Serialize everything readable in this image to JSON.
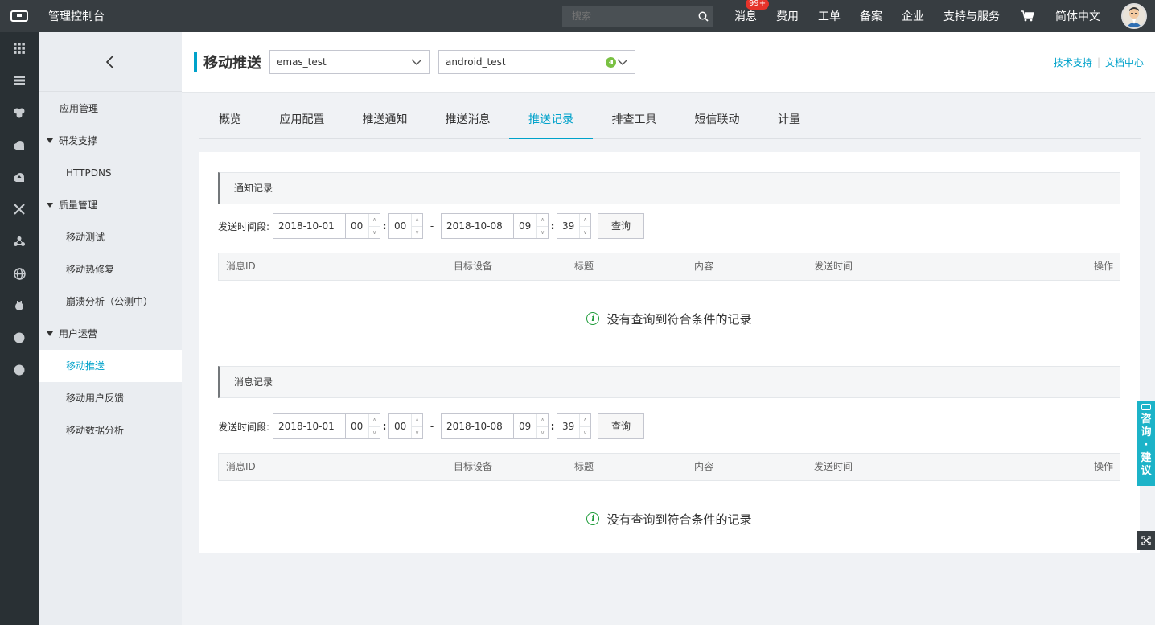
{
  "topbar": {
    "console_title": "管理控制台",
    "search_placeholder": "搜索",
    "nav": {
      "messages": "消息",
      "messages_badge": "99+",
      "billing": "费用",
      "tickets": "工单",
      "icp": "备案",
      "enterprise": "企业",
      "support": "支持与服务",
      "language": "简体中文"
    }
  },
  "rail": {
    "icons": [
      "grid-icon",
      "server-icon",
      "shield-icon",
      "cloud-icon",
      "cloud-upload-icon",
      "network-icon",
      "nodes-icon",
      "globe-icon",
      "bug-icon",
      "dot-icon",
      "dot-icon"
    ]
  },
  "sidebar": {
    "items": [
      {
        "label": "应用管理",
        "kind": "top"
      },
      {
        "label": "研发支撑",
        "kind": "group"
      },
      {
        "label": "HTTPDNS",
        "kind": "sub"
      },
      {
        "label": "质量管理",
        "kind": "group"
      },
      {
        "label": "移动测试",
        "kind": "sub"
      },
      {
        "label": "移动热修复",
        "kind": "sub"
      },
      {
        "label": "崩溃分析（公测中）",
        "kind": "sub"
      },
      {
        "label": "用户运营",
        "kind": "group"
      },
      {
        "label": "移动推送",
        "kind": "sub",
        "active": true
      },
      {
        "label": "移动用户反馈",
        "kind": "sub"
      },
      {
        "label": "移动数据分析",
        "kind": "sub"
      }
    ]
  },
  "header": {
    "title": "移动推送",
    "app_select": "emas_test",
    "platform_select": "android_test",
    "links": {
      "tech_support": "技术支持",
      "docs": "文档中心"
    }
  },
  "tabs": [
    "概览",
    "应用配置",
    "推送通知",
    "推送消息",
    "推送记录",
    "排查工具",
    "短信联动",
    "计量"
  ],
  "active_tab": "推送记录",
  "columns": [
    "消息ID",
    "目标设备",
    "标题",
    "内容",
    "发送时间",
    "操作"
  ],
  "sections": {
    "notify": {
      "title": "通知记录",
      "label": "发送时间段:",
      "start_date": "2018-10-01",
      "start_hour": "00",
      "start_min": "00",
      "end_date": "2018-10-08",
      "end_hour": "09",
      "end_min": "39",
      "query": "查询",
      "empty": "没有查询到符合条件的记录"
    },
    "message": {
      "title": "消息记录",
      "label": "发送时间段:",
      "start_date": "2018-10-01",
      "start_hour": "00",
      "start_min": "00",
      "end_date": "2018-10-08",
      "end_hour": "09",
      "end_min": "39",
      "query": "查询",
      "empty": "没有查询到符合条件的记录"
    }
  },
  "float": {
    "consult": [
      "咨",
      "询",
      "·",
      "建",
      "议"
    ]
  },
  "colors": {
    "accent": "#00a2ca",
    "topbar": "#373d41",
    "rail": "#293034",
    "success": "#1e9c3a",
    "badge": "#e5332a"
  }
}
